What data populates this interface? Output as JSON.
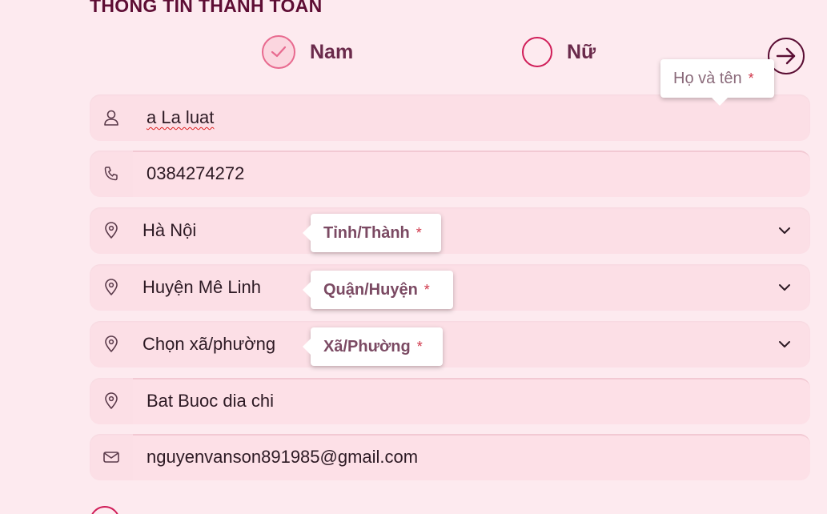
{
  "page": {
    "title": "THÔNG TIN THANH TOÁN"
  },
  "gender": {
    "options": [
      {
        "label": "Nam",
        "checked": true
      },
      {
        "label": "Nữ",
        "checked": false
      }
    ]
  },
  "fields": {
    "name": {
      "value": "a La luat",
      "tooltip": "Họ và tên",
      "required_mark": "*",
      "icon": "user-icon"
    },
    "phone": {
      "value": "0384274272",
      "icon": "phone-icon"
    },
    "province": {
      "value": "Hà Nội",
      "tooltip": "Tỉnh/Thành",
      "required_mark": "*",
      "icon": "location-pin-icon"
    },
    "district": {
      "value": "Huyện Mê Linh",
      "tooltip": "Quận/Huyện",
      "required_mark": "*",
      "icon": "location-pin-icon"
    },
    "ward": {
      "value": "Chọn xã/phường",
      "tooltip": "Xã/Phường",
      "required_mark": "*",
      "icon": "location-pin-icon"
    },
    "address": {
      "value": "Bat Buoc dia chi",
      "icon": "location-pin-icon"
    },
    "email": {
      "value": "nguyenvanson891985@gmail.com",
      "icon": "mail-icon"
    }
  },
  "colors": {
    "background": "#fdeaef",
    "field": "#fcdfe6",
    "accent": "#d01d58",
    "title": "#5e0d34"
  }
}
